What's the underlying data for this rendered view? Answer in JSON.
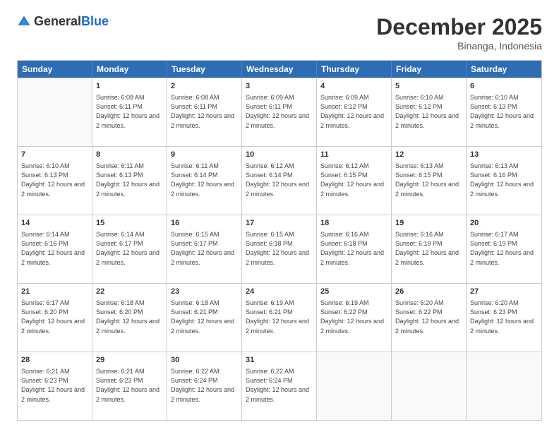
{
  "logo": {
    "general": "General",
    "blue": "Blue"
  },
  "header": {
    "month": "December 2025",
    "location": "Binanga, Indonesia"
  },
  "weekdays": [
    "Sunday",
    "Monday",
    "Tuesday",
    "Wednesday",
    "Thursday",
    "Friday",
    "Saturday"
  ],
  "rows": [
    [
      {
        "day": "",
        "empty": true
      },
      {
        "day": "1",
        "rise": "6:08 AM",
        "set": "6:11 PM",
        "daylight": "12 hours and 2 minutes."
      },
      {
        "day": "2",
        "rise": "6:08 AM",
        "set": "6:11 PM",
        "daylight": "12 hours and 2 minutes."
      },
      {
        "day": "3",
        "rise": "6:09 AM",
        "set": "6:11 PM",
        "daylight": "12 hours and 2 minutes."
      },
      {
        "day": "4",
        "rise": "6:09 AM",
        "set": "6:12 PM",
        "daylight": "12 hours and 2 minutes."
      },
      {
        "day": "5",
        "rise": "6:10 AM",
        "set": "6:12 PM",
        "daylight": "12 hours and 2 minutes."
      },
      {
        "day": "6",
        "rise": "6:10 AM",
        "set": "6:13 PM",
        "daylight": "12 hours and 2 minutes."
      }
    ],
    [
      {
        "day": "7",
        "rise": "6:10 AM",
        "set": "6:13 PM",
        "daylight": "12 hours and 2 minutes."
      },
      {
        "day": "8",
        "rise": "6:11 AM",
        "set": "6:13 PM",
        "daylight": "12 hours and 2 minutes."
      },
      {
        "day": "9",
        "rise": "6:11 AM",
        "set": "6:14 PM",
        "daylight": "12 hours and 2 minutes."
      },
      {
        "day": "10",
        "rise": "6:12 AM",
        "set": "6:14 PM",
        "daylight": "12 hours and 2 minutes."
      },
      {
        "day": "11",
        "rise": "6:12 AM",
        "set": "6:15 PM",
        "daylight": "12 hours and 2 minutes."
      },
      {
        "day": "12",
        "rise": "6:13 AM",
        "set": "6:15 PM",
        "daylight": "12 hours and 2 minutes."
      },
      {
        "day": "13",
        "rise": "6:13 AM",
        "set": "6:16 PM",
        "daylight": "12 hours and 2 minutes."
      }
    ],
    [
      {
        "day": "14",
        "rise": "6:14 AM",
        "set": "6:16 PM",
        "daylight": "12 hours and 2 minutes."
      },
      {
        "day": "15",
        "rise": "6:14 AM",
        "set": "6:17 PM",
        "daylight": "12 hours and 2 minutes."
      },
      {
        "day": "16",
        "rise": "6:15 AM",
        "set": "6:17 PM",
        "daylight": "12 hours and 2 minutes."
      },
      {
        "day": "17",
        "rise": "6:15 AM",
        "set": "6:18 PM",
        "daylight": "12 hours and 2 minutes."
      },
      {
        "day": "18",
        "rise": "6:16 AM",
        "set": "6:18 PM",
        "daylight": "12 hours and 2 minutes."
      },
      {
        "day": "19",
        "rise": "6:16 AM",
        "set": "6:19 PM",
        "daylight": "12 hours and 2 minutes."
      },
      {
        "day": "20",
        "rise": "6:17 AM",
        "set": "6:19 PM",
        "daylight": "12 hours and 2 minutes."
      }
    ],
    [
      {
        "day": "21",
        "rise": "6:17 AM",
        "set": "6:20 PM",
        "daylight": "12 hours and 2 minutes."
      },
      {
        "day": "22",
        "rise": "6:18 AM",
        "set": "6:20 PM",
        "daylight": "12 hours and 2 minutes."
      },
      {
        "day": "23",
        "rise": "6:18 AM",
        "set": "6:21 PM",
        "daylight": "12 hours and 2 minutes."
      },
      {
        "day": "24",
        "rise": "6:19 AM",
        "set": "6:21 PM",
        "daylight": "12 hours and 2 minutes."
      },
      {
        "day": "25",
        "rise": "6:19 AM",
        "set": "6:22 PM",
        "daylight": "12 hours and 2 minutes."
      },
      {
        "day": "26",
        "rise": "6:20 AM",
        "set": "6:22 PM",
        "daylight": "12 hours and 2 minutes."
      },
      {
        "day": "27",
        "rise": "6:20 AM",
        "set": "6:23 PM",
        "daylight": "12 hours and 2 minutes."
      }
    ],
    [
      {
        "day": "28",
        "rise": "6:21 AM",
        "set": "6:23 PM",
        "daylight": "12 hours and 2 minutes."
      },
      {
        "day": "29",
        "rise": "6:21 AM",
        "set": "6:23 PM",
        "daylight": "12 hours and 2 minutes."
      },
      {
        "day": "30",
        "rise": "6:22 AM",
        "set": "6:24 PM",
        "daylight": "12 hours and 2 minutes."
      },
      {
        "day": "31",
        "rise": "6:22 AM",
        "set": "6:24 PM",
        "daylight": "12 hours and 2 minutes."
      },
      {
        "day": "",
        "empty": true
      },
      {
        "day": "",
        "empty": true
      },
      {
        "day": "",
        "empty": true
      }
    ]
  ],
  "labels": {
    "sunrise": "Sunrise:",
    "sunset": "Sunset:",
    "daylight": "Daylight:"
  }
}
